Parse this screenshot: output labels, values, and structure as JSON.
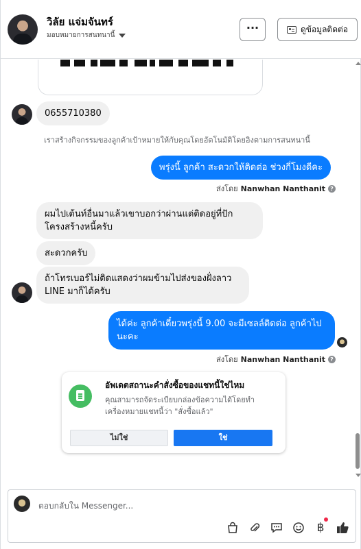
{
  "header": {
    "user_name": "วิลัย แจ่มจันทร์",
    "assign_label": "มอบหมายการสนทนานี้",
    "more_label": "···",
    "contact_button_label": "ดูข้อมูลติดต่อ"
  },
  "conversation": {
    "messages": [
      {
        "direction": "in",
        "text": "0655710380"
      },
      {
        "direction": "system",
        "text": "เราสร้างกิจกรรมของลูกค้าเป้าหมายให้กับคุณโดยอัตโนมัติโดยอิงตามการสนทนานี้"
      },
      {
        "direction": "out",
        "text": "พรุ่งนี้ ลูกค้า สะดวกให้ติดต่อ ช่วงกี่โมงดีคะ"
      },
      {
        "direction": "in",
        "text": "ผมไปเต้นท์อื่นมาแล้วเขาบอกว่าผ่านแต่ติดอยู่ที่ปัก\nโครงสร้างหนี้ครับ"
      },
      {
        "direction": "in",
        "text": "สะดวกครับ"
      },
      {
        "direction": "in",
        "text": "ถ้าโทรเบอร์ไม่ติดแสดงว่าผมข้ามไปส่งของฝั่งลาว\nLINE มาก็ได้ครับ"
      },
      {
        "direction": "out",
        "text": "ได้ค่ะ ลูกค้าเดี๋ยวพรุ่งนี้ 9.00 จะมีเซลล์ติดต่อ ลูกค้าไป\nนะคะ"
      }
    ],
    "sent_by_prefix": "ส่งโดย",
    "sent_by_name": "Nanwhan Nanthanit",
    "help_glyph": "?"
  },
  "update_card": {
    "title": "อัพเดตสถานะคำสั่งซื้อของแชทนี้ใช่ไหม",
    "body": "คุณสามารถจัดระเบียบกล่องข้อความได้โดยทำเครื่องหมายแชทนี้ว่า \"สั่งซื้อแล้ว\"",
    "no_label": "ไม่ใช่",
    "yes_label": "ใช่"
  },
  "composer": {
    "placeholder": "ตอบกลับใน Messenger...",
    "tools": [
      "shopping-bag-icon",
      "attachment-icon",
      "saved-reply-icon",
      "emoji-icon",
      "payment-icon",
      "like-icon"
    ],
    "baht_glyph": "฿"
  },
  "colors": {
    "outgoing_bubble": "#0a7cff",
    "incoming_bubble": "#f0f0f0",
    "primary_button": "#1877f2",
    "badge_green": "#45bd62"
  }
}
